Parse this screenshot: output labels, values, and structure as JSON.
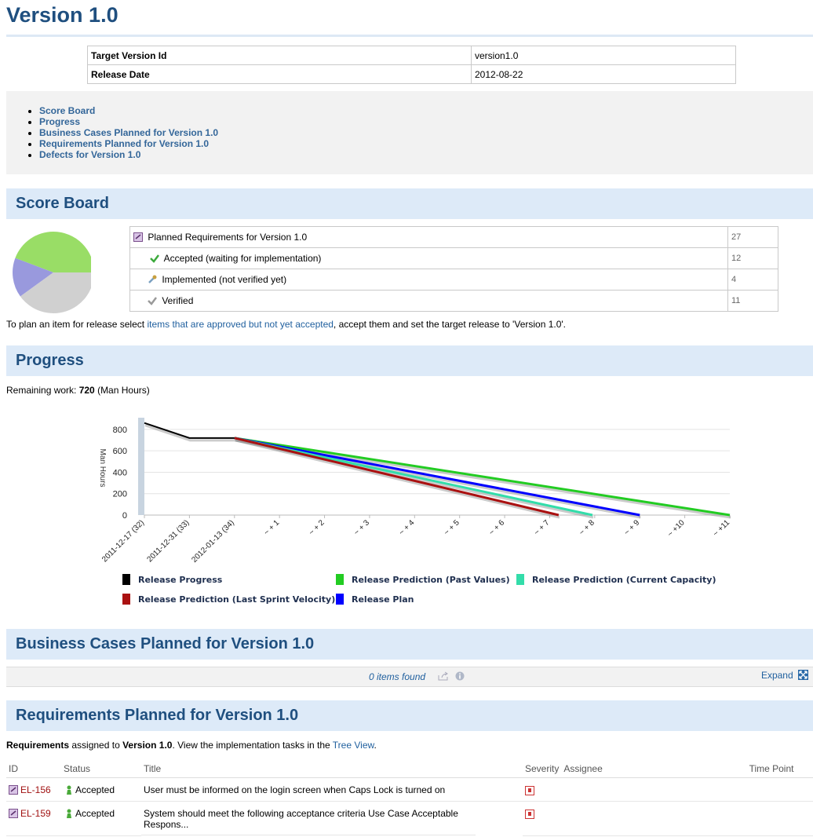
{
  "page": {
    "title": "Version 1.0"
  },
  "props": [
    {
      "key": "Target Version Id",
      "value": "version1.0"
    },
    {
      "key": "Release Date",
      "value": "2012-08-22"
    }
  ],
  "toc": [
    "Score Board",
    "Progress",
    "Business Cases Planned for Version 1.0",
    "Requirements Planned for Version 1.0",
    "Defects for Version 1.0"
  ],
  "sections": {
    "score": "Score Board",
    "progress": "Progress",
    "business": "Business Cases Planned for Version 1.0",
    "requirements": "Requirements Planned for Version 1.0"
  },
  "scoreboard": {
    "rows": [
      {
        "label": "Planned Requirements for Version 1.0",
        "value": "27",
        "icon": "requirement-icon"
      },
      {
        "label": "Accepted (waiting for implementation)",
        "value": "12",
        "icon": "checkmark-green-icon"
      },
      {
        "label": "Implemented (not verified yet)",
        "value": "4",
        "icon": "wrench-icon"
      },
      {
        "label": "Verified",
        "value": "11",
        "icon": "checkmark-gray-icon"
      }
    ],
    "pie_colors": {
      "accepted": "#99dd66",
      "implemented": "#9999dd",
      "verified": "#d0d0d0"
    }
  },
  "plan_note": {
    "pre": "To plan an item for release select ",
    "link": "items that are approved but not yet accepted",
    "post": ", accept them and set the target release to 'Version 1.0'."
  },
  "remaining": {
    "pre": "Remaining work: ",
    "value": "720",
    "post": " (Man Hours)"
  },
  "chart_data": {
    "type": "line",
    "ylabel": "Man Hours",
    "ylim": [
      0,
      880
    ],
    "yticks": [
      "800",
      "600",
      "400",
      "200",
      "0"
    ],
    "categories": [
      "2011-12-17 (32)",
      "2011-12-31 (33)",
      "2012-01-13 (34)",
      "~ + 1",
      "~ + 2",
      "~ + 3",
      "~ + 4",
      "~ + 5",
      "~ + 6",
      "~ + 7",
      "~ + 8",
      "~ + 9",
      "~ +10",
      "~ +11"
    ],
    "series": [
      {
        "name": "Release Progress",
        "color": "#000000",
        "values": [
          860,
          720,
          720
        ]
      },
      {
        "name": "Release Prediction (Past Values)",
        "color": "#22cc22",
        "start_index": 2,
        "start_value": 720,
        "end_index": 13,
        "end_value": 0
      },
      {
        "name": "Release Prediction (Current Capacity)",
        "color": "#33ddaa",
        "start_index": 2,
        "start_value": 720,
        "end_index": 9.95,
        "end_value": 0
      },
      {
        "name": "Release Prediction (Last Sprint Velocity)",
        "color": "#aa1111",
        "start_index": 2,
        "start_value": 720,
        "end_index": 9.2,
        "end_value": 0
      },
      {
        "name": "Release Plan",
        "color": "#0000ff",
        "start_index": 2,
        "start_value": 720,
        "end_index": 11.0,
        "end_value": 0
      }
    ],
    "legend": [
      "Release Progress",
      "Release Prediction (Past Values)",
      "Release Prediction (Current Capacity)",
      "Release Prediction (Last Sprint Velocity)",
      "Release Plan"
    ]
  },
  "business": {
    "items_found": "0 items found",
    "expand": "Expand"
  },
  "requirements": {
    "note": {
      "b1": "Requirements",
      "t1": " assigned to ",
      "b2": "Version 1.0",
      "t2": ". View the implementation tasks in the ",
      "link": "Tree View",
      "t3": "."
    },
    "columns": [
      "ID",
      "Status",
      "Title",
      "Severity",
      "Assignee",
      "Time Point"
    ],
    "rows": [
      {
        "id": "EL-156",
        "status": "Accepted",
        "title": "User must be informed on the login screen when Caps Lock is turned on"
      },
      {
        "id": "EL-159",
        "status": "Accepted",
        "title": "System should meet the following acceptance criteria Use Case Acceptable Respons..."
      }
    ]
  }
}
